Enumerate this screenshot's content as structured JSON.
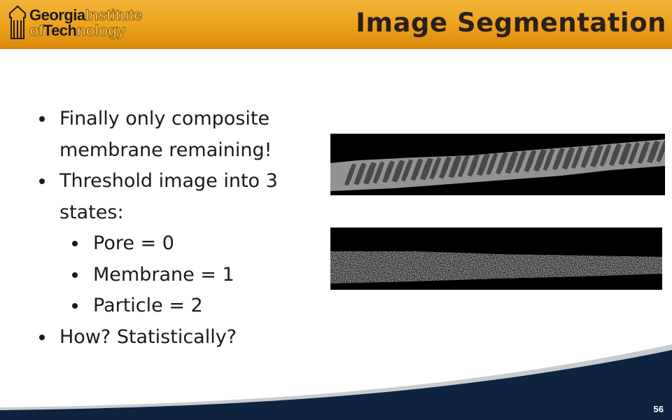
{
  "header": {
    "logo": {
      "line1_bold": "Georgia",
      "line1_light": "Institute",
      "line2_light1": "of",
      "line2_bold": "Tech",
      "line2_light2": "nology"
    },
    "title": "Image Segmentation"
  },
  "bullets": [
    {
      "level": 1,
      "text": "Finally only composite"
    },
    {
      "level": 1,
      "text": "membrane remaining!",
      "continuation": true
    },
    {
      "level": 1,
      "text": "Threshold image into 3"
    },
    {
      "level": 1,
      "text": "states:",
      "continuation": true
    },
    {
      "level": 2,
      "text": "Pore = 0"
    },
    {
      "level": 2,
      "text": "Membrane = 1"
    },
    {
      "level": 2,
      "text": "Particle = 2"
    },
    {
      "level": 1,
      "text": "How? Statistically?"
    }
  ],
  "images": [
    {
      "name": "membrane-pores-image",
      "icon": "grayscale-micrograph"
    },
    {
      "name": "membrane-texture-image",
      "icon": "grayscale-micrograph"
    }
  ],
  "footer": {
    "page_number": "56",
    "colors": {
      "navy": "#0d2340",
      "silver": "#c8ccd2"
    }
  },
  "theme": {
    "header_gold": "#eca21c",
    "title_color": "#2b1f1a"
  }
}
